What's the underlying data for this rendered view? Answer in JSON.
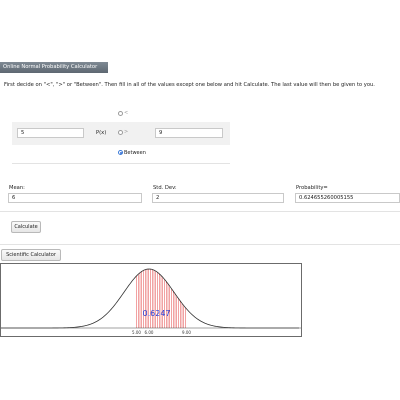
{
  "window": {
    "title": "Online Normal Probability Calculator"
  },
  "instructions": "First decide on \"<\", \">\" or \"Between\".  Then fill in all of the values except one below and hit Calculate.  The last value will then be given to you.",
  "probability_row": {
    "lower_value": "5",
    "px_label": "P(x)",
    "upper_value": "9",
    "options": [
      {
        "label": "<",
        "selected": false
      },
      {
        "label": ">",
        "selected": false
      },
      {
        "label": "Between",
        "selected": true
      }
    ]
  },
  "parameters": {
    "mean_label": "Mean:",
    "mean_value": "6",
    "sd_label": "Std. Dev:",
    "sd_value": "2",
    "probability_label": "Probability=",
    "probability_value": "0.624655260005155"
  },
  "buttons": {
    "calculate": "Calculate",
    "scientific_calculator": "Scientific Calculator"
  },
  "chart_data": {
    "type": "area",
    "mean": 6,
    "std_dev": 2,
    "shaded_from": 5,
    "shaded_to": 9,
    "shaded_area_label": "0.6247",
    "tick_labels": [
      "5.00",
      "6.00",
      "9.00"
    ],
    "colors": {
      "curve": "#333333",
      "shading": "#e03030",
      "area_label": "#2a3fd6"
    }
  }
}
